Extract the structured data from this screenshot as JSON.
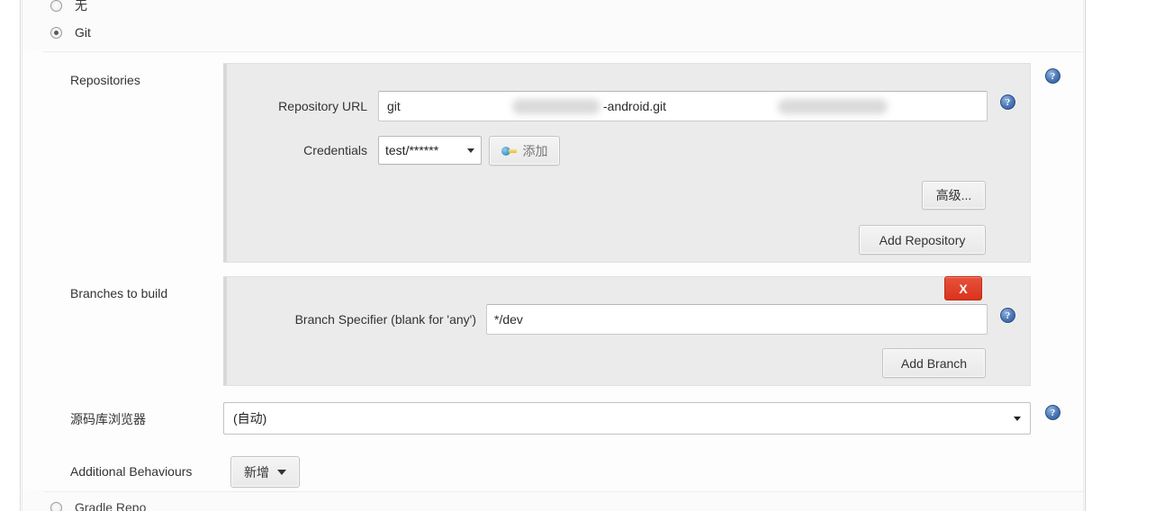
{
  "scm_options": [
    {
      "label": "无",
      "checked": false
    },
    {
      "label": "Git",
      "checked": true
    },
    {
      "label": "Gradle Repo",
      "checked": false
    }
  ],
  "repositories": {
    "section_label": "Repositories",
    "url_label": "Repository URL",
    "url_prefix": "git",
    "url_suffix": "-android.git",
    "credentials_label": "Credentials",
    "credentials_value": "test/******",
    "add_credentials_button": "添加",
    "advanced_button": "高级...",
    "add_repository_button": "Add Repository"
  },
  "branches": {
    "section_label": "Branches to build",
    "specifier_label": "Branch Specifier (blank for 'any')",
    "specifier_value": "*/dev",
    "delete_button": "X",
    "add_branch_button": "Add Branch"
  },
  "repository_browser": {
    "section_label": "源码库浏览器",
    "selected": "(自动)"
  },
  "additional_behaviours": {
    "section_label": "Additional Behaviours",
    "add_button": "新增"
  },
  "help_icon_glyph": "?",
  "colors": {
    "panel_bg": "#ebebeb",
    "delete_red": "#d9331d",
    "help_blue": "#4a77b5"
  }
}
